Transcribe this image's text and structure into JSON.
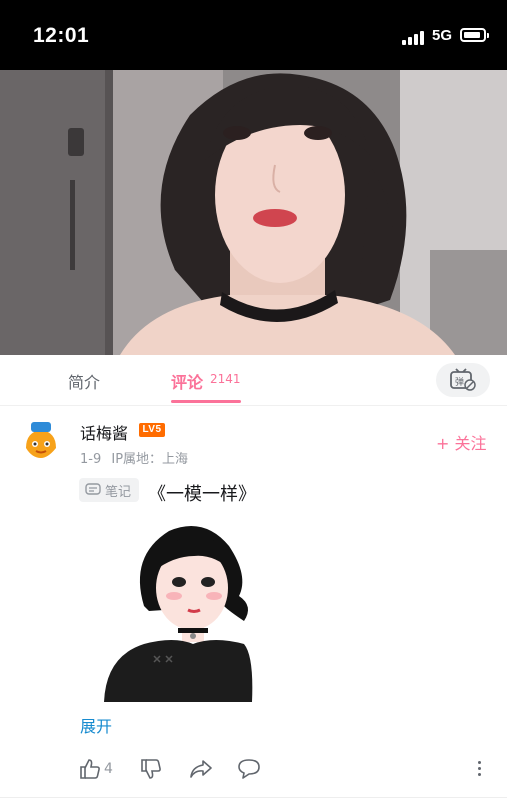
{
  "status_bar": {
    "time": "12:01",
    "network": "5G",
    "icons": [
      "signal-icon",
      "battery-icon"
    ]
  },
  "video": {
    "description_icon": "video-player"
  },
  "tabs": {
    "intro_label": "简介",
    "comments_label": "评论",
    "comments_count": "2141",
    "danmaku_icon": "danmaku-toggle-icon",
    "accent_color": "#fb7299"
  },
  "comment": {
    "username": "话梅酱",
    "level": "LV5",
    "follow_label": "+ 关注",
    "date": "1-9",
    "ip_location": "IP属地：上海",
    "note_tag": "笔记",
    "text": "《一模一样》",
    "expand_label": "展开",
    "like_count": "4"
  }
}
